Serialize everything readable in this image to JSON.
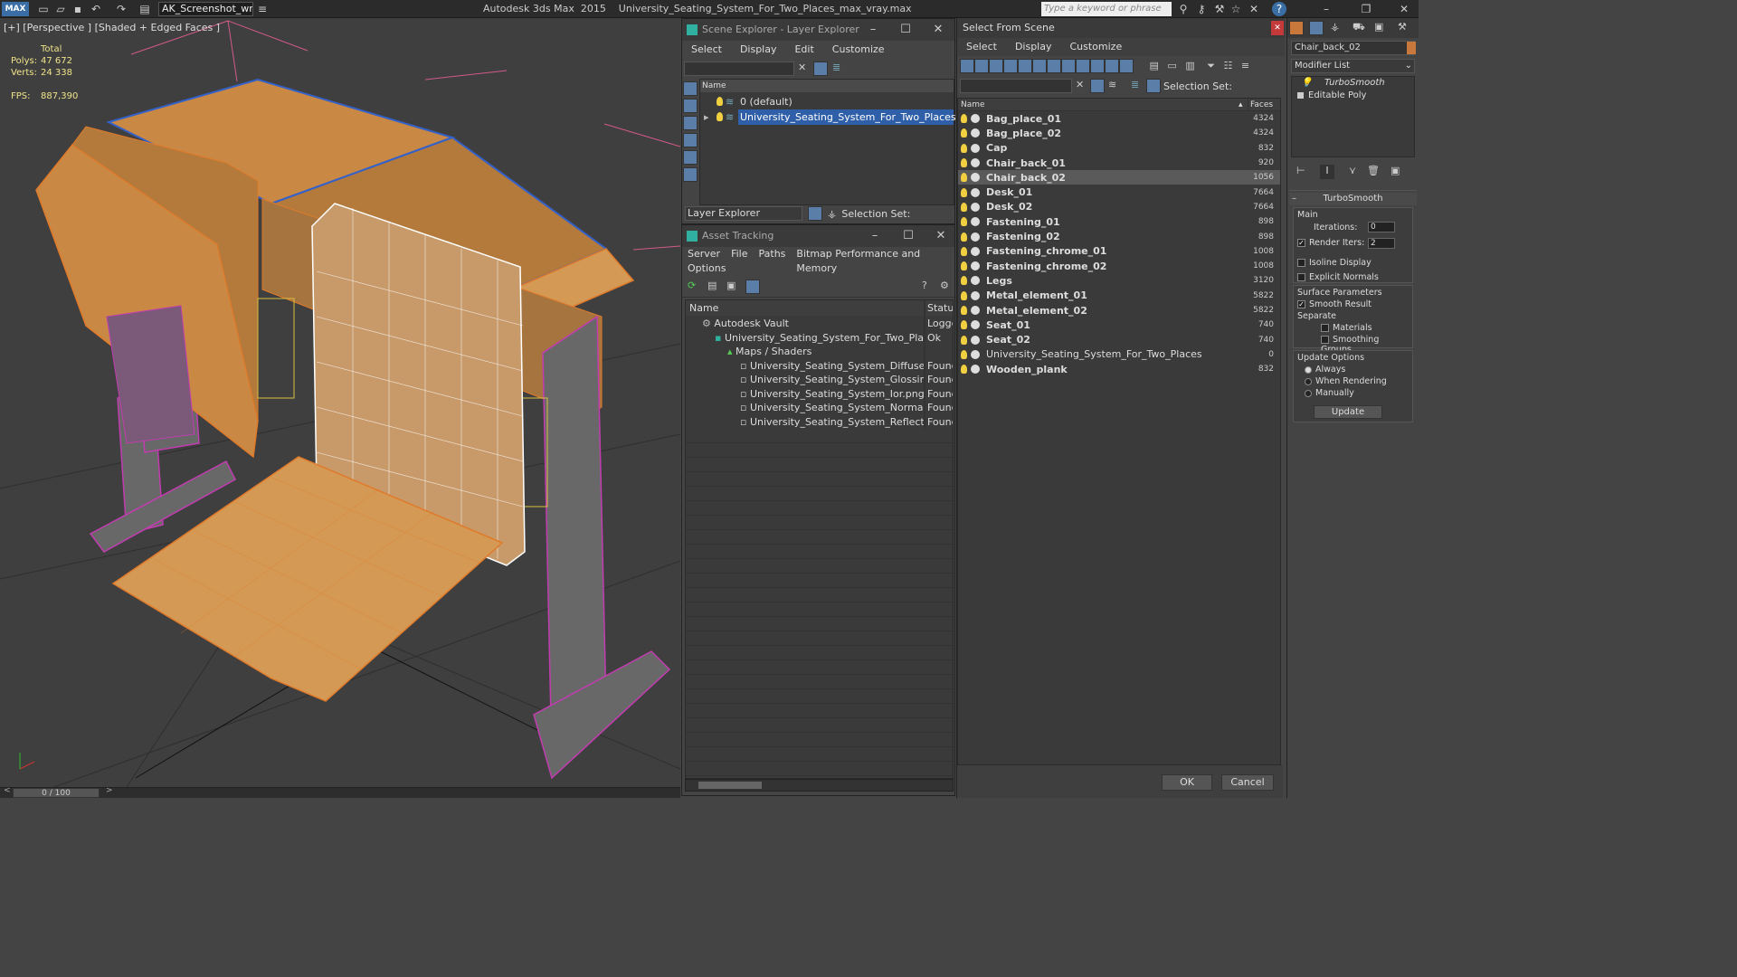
{
  "titlebar": {
    "workspace": "AK_Screenshot_wrksp",
    "title": "Autodesk 3ds Max  2015    University_Seating_System_For_Two_Places_max_vray.max",
    "search_placeholder": "Type a keyword or phrase",
    "logo": "MAX"
  },
  "viewport": {
    "label": "[+] [Perspective ] [Shaded + Edged Faces ]",
    "stats_total": "Total",
    "polys_label": "Polys:",
    "polys_value": "47 672",
    "verts_label": "Verts:",
    "verts_value": "24 338",
    "fps_label": "FPS:",
    "fps_value": "887,390"
  },
  "timeline": {
    "frame": "0 / 100"
  },
  "scene_explorer": {
    "title": "Scene Explorer - Layer Explorer",
    "menu": [
      "Select",
      "Display",
      "Edit",
      "Customize"
    ],
    "col_name": "Name",
    "layers": [
      "0 (default)",
      "University_Seating_System_For_Two_Places"
    ],
    "footer_label": "Layer Explorer",
    "selection_set": "Selection Set:"
  },
  "asset_tracking": {
    "title": "Asset Tracking",
    "menu": [
      "Server",
      "File",
      "Paths",
      "Bitmap Performance and Memory"
    ],
    "menu2": "Options",
    "col_name": "Name",
    "col_status": "Status",
    "rows": [
      {
        "name": "Autodesk Vault",
        "status": "Logged"
      },
      {
        "name": "University_Seating_System_For_Two_Places_max...",
        "status": "Ok"
      },
      {
        "name": "Maps / Shaders",
        "status": ""
      },
      {
        "name": "University_Seating_System_Diffuse.png",
        "status": "Found"
      },
      {
        "name": "University_Seating_System_Glossiness.png",
        "status": "Found"
      },
      {
        "name": "University_Seating_System_Ior.png",
        "status": "Found"
      },
      {
        "name": "University_Seating_System_Normal.png",
        "status": "Found"
      },
      {
        "name": "University_Seating_System_Reflection.png",
        "status": "Found"
      }
    ]
  },
  "select_from_scene": {
    "title": "Select From Scene",
    "menu": [
      "Select",
      "Display",
      "Customize"
    ],
    "selection_set": "Selection Set:",
    "col_name": "Name",
    "col_faces": "Faces",
    "objects": [
      {
        "name": "Bag_place_01",
        "faces": "4324"
      },
      {
        "name": "Bag_place_02",
        "faces": "4324"
      },
      {
        "name": "Cap",
        "faces": "832"
      },
      {
        "name": "Chair_back_01",
        "faces": "920"
      },
      {
        "name": "Chair_back_02",
        "faces": "1056"
      },
      {
        "name": "Desk_01",
        "faces": "7664"
      },
      {
        "name": "Desk_02",
        "faces": "7664"
      },
      {
        "name": "Fastening_01",
        "faces": "898"
      },
      {
        "name": "Fastening_02",
        "faces": "898"
      },
      {
        "name": "Fastening_chrome_01",
        "faces": "1008"
      },
      {
        "name": "Fastening_chrome_02",
        "faces": "1008"
      },
      {
        "name": "Legs",
        "faces": "3120"
      },
      {
        "name": "Metal_element_01",
        "faces": "5822"
      },
      {
        "name": "Metal_element_02",
        "faces": "5822"
      },
      {
        "name": "Seat_01",
        "faces": "740"
      },
      {
        "name": "Seat_02",
        "faces": "740"
      },
      {
        "name": "University_Seating_System_For_Two_Places",
        "faces": "0"
      },
      {
        "name": "Wooden_plank",
        "faces": "832"
      }
    ],
    "ok": "OK",
    "cancel": "Cancel"
  },
  "command_panel": {
    "object_name": "Chair_back_02",
    "modifier_list": "Modifier List",
    "stack": [
      "TurboSmooth",
      "Editable Poly"
    ],
    "rollout_title": "TurboSmooth",
    "main": "Main",
    "iterations_label": "Iterations:",
    "iterations_value": "0",
    "render_iters_label": "Render Iters:",
    "render_iters_value": "2",
    "isoline": "Isoline Display",
    "explicit_normals": "Explicit Normals",
    "surface_params": "Surface Parameters",
    "smooth_result": "Smooth Result",
    "separate": "Separate",
    "materials": "Materials",
    "smoothing_groups": "Smoothing Groups",
    "update_options": "Update Options",
    "always": "Always",
    "when_rendering": "When Rendering",
    "manually": "Manually",
    "update_button": "Update"
  },
  "colors": {
    "selection": "#2f5fa8",
    "wood": "#d9974a",
    "legs": "#c23cb0"
  }
}
